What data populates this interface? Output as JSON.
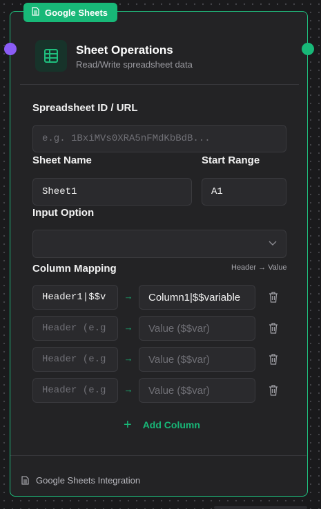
{
  "node": {
    "badge_label": "Google Sheets",
    "title": "Sheet Operations",
    "subtitle": "Read/Write spreadsheet data",
    "footer_label": "Google Sheets Integration"
  },
  "fields": {
    "spreadsheet": {
      "label": "Spreadsheet ID / URL",
      "placeholder": "e.g. 1BxiMVs0XRA5nFMdKbBdB..."
    },
    "sheet_name": {
      "label": "Sheet Name",
      "value": "Sheet1"
    },
    "start_range": {
      "label": "Start Range",
      "value": "A1"
    },
    "input_option": {
      "label": "Input Option",
      "value": ""
    }
  },
  "column_mapping": {
    "label": "Column Mapping",
    "hint": "Header → Value",
    "arrow": "→",
    "rows": [
      {
        "header": "Header1|$$v",
        "value": "Column1|$$variable",
        "header_placeholder": false,
        "value_placeholder": false
      },
      {
        "header": "Header (e.g",
        "value": "Value ($$var)",
        "header_placeholder": true,
        "value_placeholder": true
      },
      {
        "header": "Header (e.g",
        "value": "Value ($$var)",
        "header_placeholder": true,
        "value_placeholder": true
      },
      {
        "header": "Header (e.g",
        "value": "Value ($$var)",
        "header_placeholder": true,
        "value_placeholder": true
      }
    ],
    "add_label": "Add Column",
    "add_icon": "+"
  },
  "colors": {
    "accent": "#18b878",
    "input_port": "#8b5cf6",
    "card_bg": "#232325"
  }
}
